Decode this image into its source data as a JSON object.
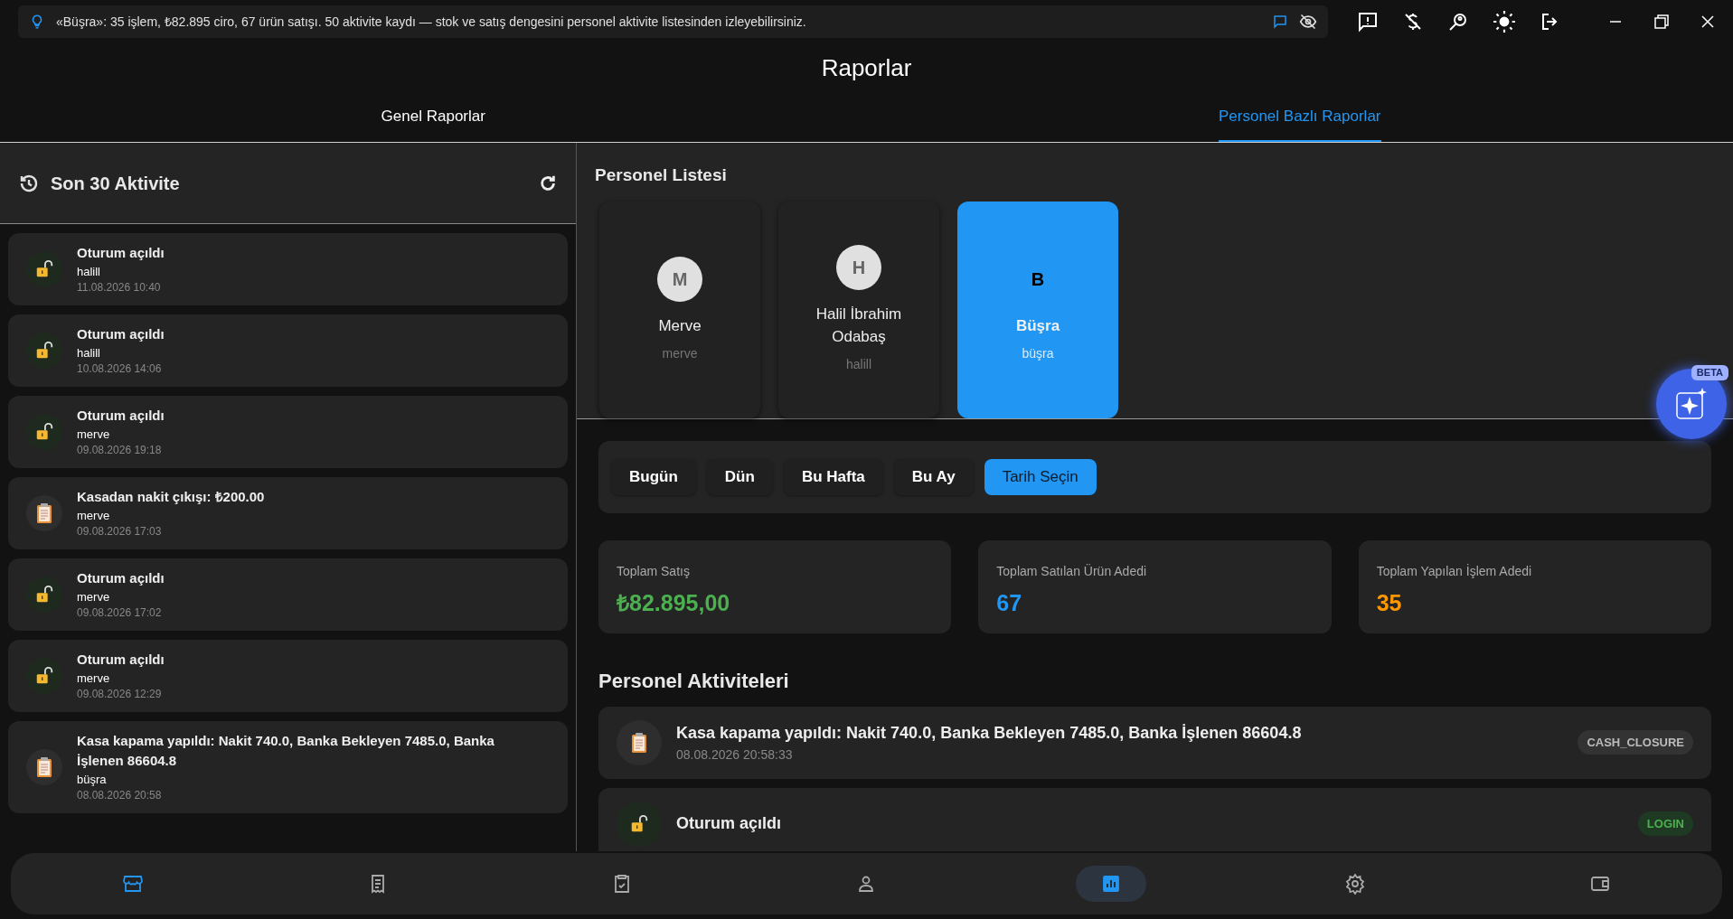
{
  "hint_bar": {
    "text": "«Büşra»: 35 işlem, ₺82.895 ciro, 67 ürün satışı. 50 aktivite kaydı — stok ve satış dengesini personel aktivite listesinden izleyebilirsiniz."
  },
  "page_title": "Raporlar",
  "tabs": [
    {
      "label": "Genel Raporlar",
      "selected": false
    },
    {
      "label": "Personel Bazlı Raporlar",
      "selected": true
    }
  ],
  "recent": {
    "title": "Son 30 Aktivite",
    "items": [
      {
        "kind": "login",
        "title": "Oturum açıldı",
        "user": "halill",
        "time": "11.08.2026 10:40"
      },
      {
        "kind": "login",
        "title": "Oturum açıldı",
        "user": "halill",
        "time": "10.08.2026 14:06"
      },
      {
        "kind": "login",
        "title": "Oturum açıldı",
        "user": "merve",
        "time": "09.08.2026 19:18"
      },
      {
        "kind": "note",
        "title": "Kasadan nakit çıkışı: ₺200.00",
        "user": "merve",
        "time": "09.08.2026 17:03"
      },
      {
        "kind": "login",
        "title": "Oturum açıldı",
        "user": "merve",
        "time": "09.08.2026 17:02"
      },
      {
        "kind": "login",
        "title": "Oturum açıldı",
        "user": "merve",
        "time": "09.08.2026 12:29"
      },
      {
        "kind": "note",
        "title": "Kasa kapama yapıldı: Nakit 740.0, Banka Bekleyen 7485.0, Banka İşlenen 86604.8",
        "user": "büşra",
        "time": "08.08.2026 20:58"
      }
    ]
  },
  "staff": {
    "title": "Personel Listesi",
    "items": [
      {
        "initial": "M",
        "name": "Merve",
        "username": "merve",
        "selected": false
      },
      {
        "initial": "H",
        "name": "Halil İbrahim Odabaş",
        "username": "halill",
        "selected": false
      },
      {
        "initial": "B",
        "name": "Büşra",
        "username": "büşra",
        "selected": true
      }
    ]
  },
  "beta_badge": "BETA",
  "periods": [
    {
      "label": "Bugün",
      "selected": false
    },
    {
      "label": "Dün",
      "selected": false
    },
    {
      "label": "Bu Hafta",
      "selected": false
    },
    {
      "label": "Bu Ay",
      "selected": false
    },
    {
      "label": "Tarih Seçin",
      "selected": true
    }
  ],
  "stats": [
    {
      "label": "Toplam Satış",
      "value": "₺82.895,00",
      "color": "#4caf50"
    },
    {
      "label": "Toplam Satılan Ürün Adedi",
      "value": "67",
      "color": "#2196f3"
    },
    {
      "label": "Toplam Yapılan İşlem Adedi",
      "value": "35",
      "color": "#ff9800"
    }
  ],
  "activities": {
    "title": "Personel Aktiviteleri",
    "items": [
      {
        "kind": "note",
        "title": "Kasa kapama yapıldı: Nakit 740.0, Banka Bekleyen 7485.0, Banka İşlenen 86604.8",
        "time": "08.08.2026 20:58:33",
        "badge": "CASH_CLOSURE",
        "color": "#bbbbbb"
      },
      {
        "kind": "login",
        "title": "Oturum açıldı",
        "badge": "LOGIN",
        "color": "#4caf50"
      }
    ]
  },
  "nav": [
    {
      "selected": false,
      "accent": true
    },
    {
      "selected": false,
      "accent": false
    },
    {
      "selected": false,
      "accent": false
    },
    {
      "selected": false,
      "accent": false
    },
    {
      "selected": true,
      "accent": false
    },
    {
      "selected": false,
      "accent": false
    },
    {
      "selected": false,
      "accent": false
    }
  ]
}
